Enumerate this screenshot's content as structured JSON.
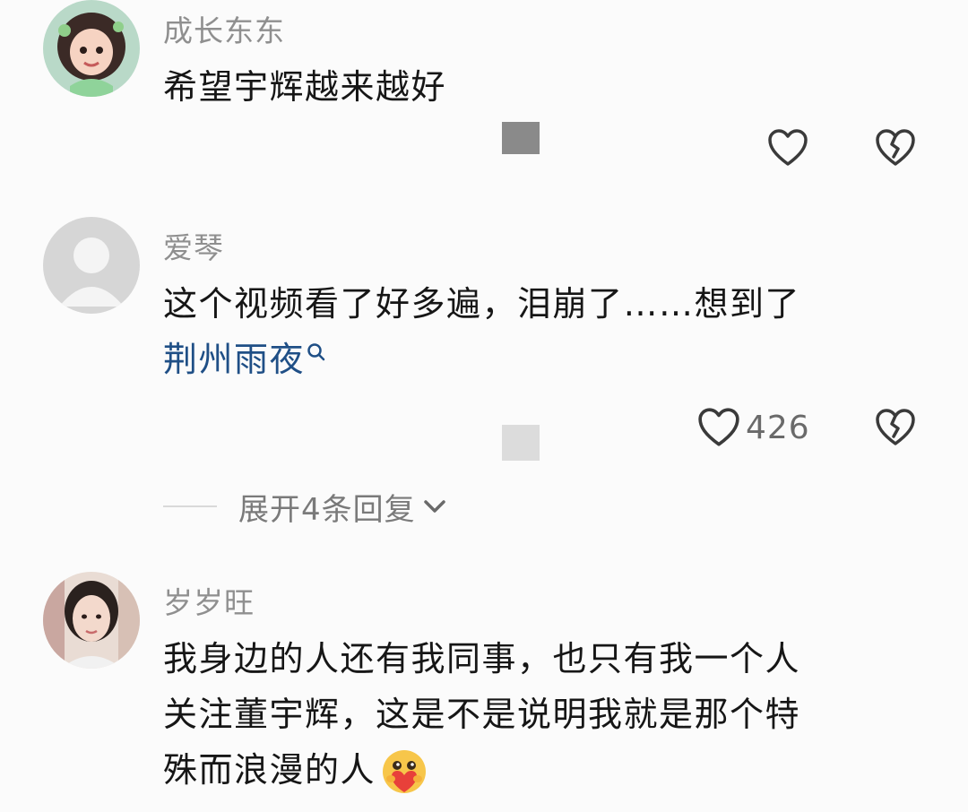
{
  "comments": [
    {
      "username": "成长东东",
      "lines": [
        "希望宇辉越来越好"
      ],
      "like_count": "",
      "avatar": "illustrated-girl-avatar"
    },
    {
      "username": "爱琴",
      "lines": [
        "这个视频看了好多遍，泪崩了……想到了"
      ],
      "link_text": "荆州雨夜",
      "like_count": "426",
      "avatar": "default-person-avatar"
    },
    {
      "username": "岁岁旺",
      "lines": [
        "我身边的人还有我同事，也只有我一个人",
        "关注董宇辉，这是不是说明我就是那个特",
        "殊而浪漫的人"
      ],
      "like_count": "",
      "avatar": "woman-photo-avatar"
    }
  ],
  "replies": {
    "label": "展开4条回复"
  },
  "icons": {
    "like": "heart-outline-icon",
    "dislike": "broken-heart-icon",
    "search": "search-icon",
    "expand": "chevron-down-icon",
    "emoji": "heart-hug-emoji-icon"
  },
  "colors": {
    "link": "#1f4f86",
    "username": "#8f8f8f",
    "text": "#161616",
    "icon": "#3a3a3a"
  }
}
